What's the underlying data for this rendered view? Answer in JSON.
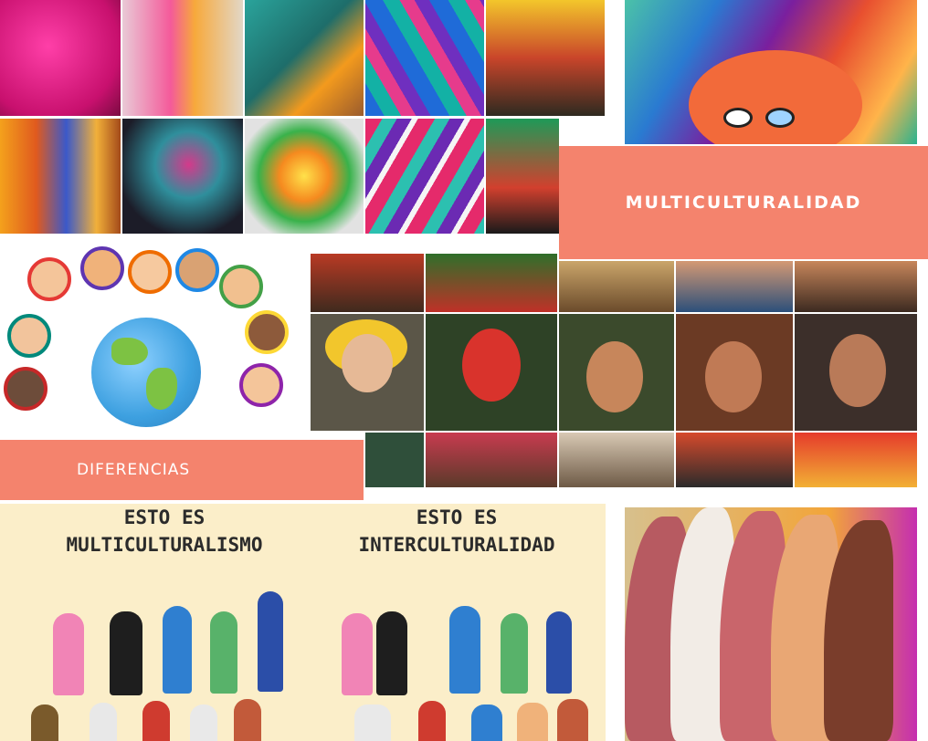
{
  "banners": {
    "main_title": "MULTICULTURALIDAD",
    "differences_label": "DIFERENCIAS"
  },
  "poster": {
    "left_heading_line1": "ESTO ES",
    "left_heading_line2": "MULTICULTURALISMO",
    "right_heading_line1": "ESTO ES",
    "right_heading_line2": "INTERCULTURALIDAD"
  },
  "colors": {
    "banner": "#f4836d",
    "poster_bg": "#fbeec9"
  },
  "icons": [
    "globe-icon",
    "children-circle",
    "faces-profile-art"
  ]
}
